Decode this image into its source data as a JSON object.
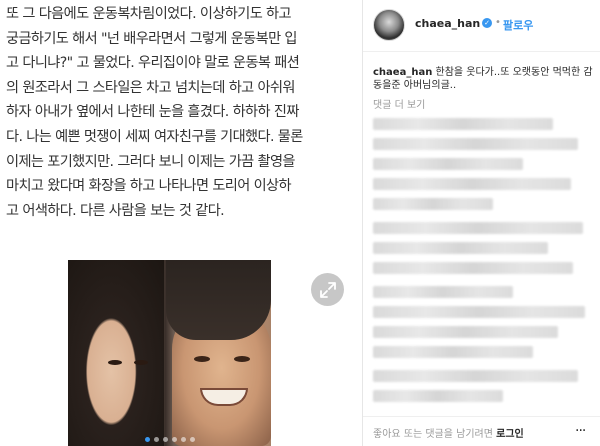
{
  "article": {
    "lines": [
      "또 그 다음에도 운동복차림이었다. 이상하기도 하고",
      "궁금하기도 해서 \"넌 배우라면서 그렇게 운동복만 입",
      "고 다니냐?\" 고 물었다. 우리집이야 말로 운동복 패션",
      "의 원조라서 그 스타일은 차고 넘치는데 하고 아쉬워",
      "하자 아내가 옆에서 나한테 눈을 흘겼다. 하하하 진짜",
      "다. 나는 예쁜 멋쟁이 세찌 여자친구를 기대했다. 물론",
      " 이제는 포기했지만. 그러다 보니 이제는 가끔 촬영을",
      " 마치고 왔다며 화장을 하고 나타나면 도리어 이상하",
      "고 어색하다. 다른 사람을 보는 것 같다."
    ],
    "expand_icon": "expand-arrows-icon",
    "carousel": {
      "count": 6,
      "active_index": 0
    }
  },
  "instagram": {
    "username": "chaea_han",
    "separator": "•",
    "follow_label": "팔로우",
    "caption_user": "chaea_han",
    "caption_text": " 한참을 웃다가..또 오랫동안 먹먹한 감동을준 아버님의글..",
    "more_comments": "댓글 더 보기",
    "footer_prefix": "좋아요 또는 댓글을 남기려면 ",
    "footer_login": "로그인",
    "footer_more": "···",
    "accent_color": "#3897f0"
  }
}
